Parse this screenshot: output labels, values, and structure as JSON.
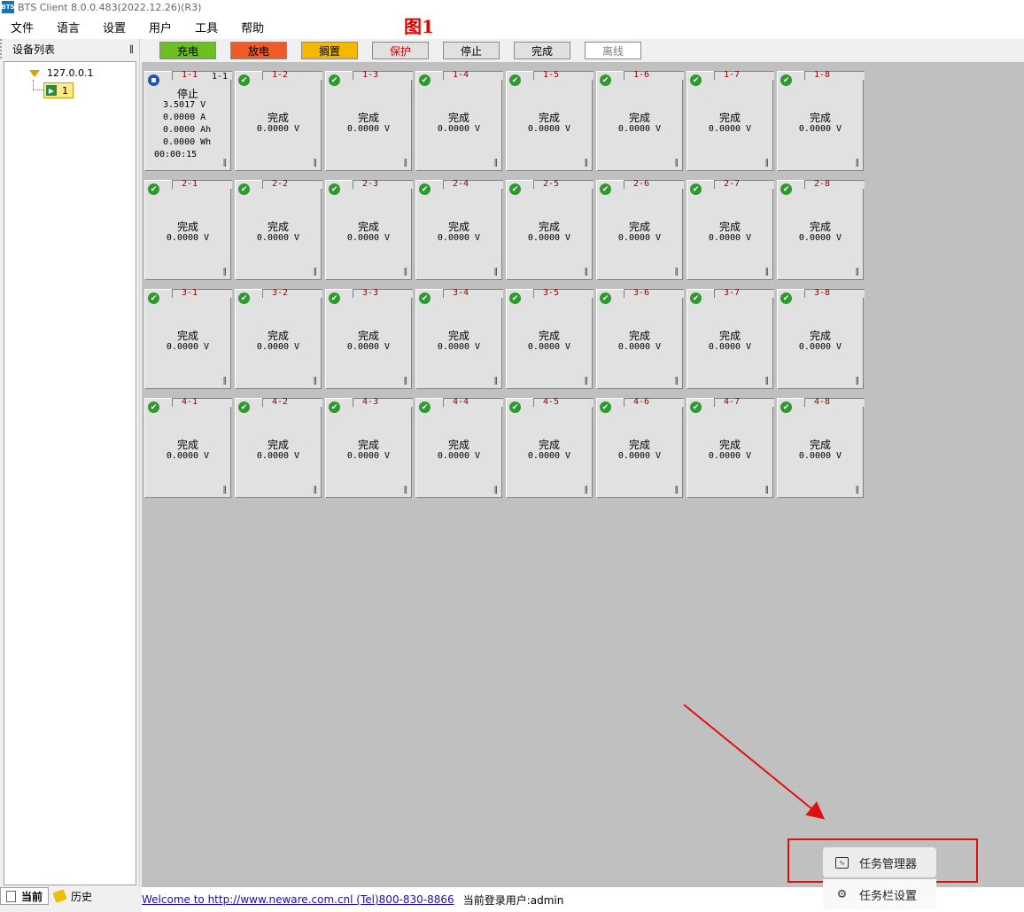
{
  "window": {
    "title": "BTS Client 8.0.0.483(2022.12.26)(R3)",
    "icon_label": "BTS"
  },
  "menu": [
    "文件",
    "语言",
    "设置",
    "用户",
    "工具",
    "帮助"
  ],
  "figure_label": "图1",
  "sidebar": {
    "title": "设备列表",
    "pin_icon": "pin-icon",
    "tree": {
      "ip": "127.0.0.1",
      "device": "1"
    },
    "tabs": [
      {
        "label": "当前",
        "active": true,
        "icon": "document-icon"
      },
      {
        "label": "历史",
        "active": false,
        "icon": "tag-icon"
      }
    ]
  },
  "legend": [
    {
      "label": "充电",
      "bg": "#6bbf20",
      "fg": "#000000"
    },
    {
      "label": "放电",
      "bg": "#f05a24",
      "fg": "#000000"
    },
    {
      "label": "搁置",
      "bg": "#f5b800",
      "fg": "#000000"
    },
    {
      "label": "保护",
      "bg": "#e1e1e1",
      "fg": "#d00000"
    },
    {
      "label": "停止",
      "bg": "#e1e1e1",
      "fg": "#000000"
    },
    {
      "label": "完成",
      "bg": "#e1e1e1",
      "fg": "#000000"
    },
    {
      "label": "离线",
      "bg": "#ffffff",
      "fg": "#808080"
    }
  ],
  "channels": {
    "rows": [
      [
        {
          "id": "1-1",
          "state": "停止",
          "icon": "stop-icon",
          "tag": "1-1",
          "details": [
            "3.5017 V",
            "0.0000 A",
            "0.0000 Ah",
            "0.0000 Wh",
            "00:00:15"
          ]
        },
        {
          "id": "1-2",
          "state": "完成",
          "value": "0.0000 V"
        },
        {
          "id": "1-3",
          "state": "完成",
          "value": "0.0000 V"
        },
        {
          "id": "1-4",
          "state": "完成",
          "value": "0.0000 V"
        },
        {
          "id": "1-5",
          "state": "完成",
          "value": "0.0000 V"
        },
        {
          "id": "1-6",
          "state": "完成",
          "value": "0.0000 V"
        },
        {
          "id": "1-7",
          "state": "完成",
          "value": "0.0000 V"
        },
        {
          "id": "1-8",
          "state": "完成",
          "value": "0.0000 V"
        }
      ],
      [
        {
          "id": "2-1",
          "state": "完成",
          "value": "0.0000 V"
        },
        {
          "id": "2-2",
          "state": "完成",
          "value": "0.0000 V"
        },
        {
          "id": "2-3",
          "state": "完成",
          "value": "0.0000 V"
        },
        {
          "id": "2-4",
          "state": "完成",
          "value": "0.0000 V"
        },
        {
          "id": "2-5",
          "state": "完成",
          "value": "0.0000 V"
        },
        {
          "id": "2-6",
          "state": "完成",
          "value": "0.0000 V"
        },
        {
          "id": "2-7",
          "state": "完成",
          "value": "0.0000 V"
        },
        {
          "id": "2-8",
          "state": "完成",
          "value": "0.0000 V"
        }
      ],
      [
        {
          "id": "3-1",
          "state": "完成",
          "value": "0.0000 V"
        },
        {
          "id": "3-2",
          "state": "完成",
          "value": "0.0000 V"
        },
        {
          "id": "3-3",
          "state": "完成",
          "value": "0.0000 V"
        },
        {
          "id": "3-4",
          "state": "完成",
          "value": "0.0000 V"
        },
        {
          "id": "3-5",
          "state": "完成",
          "value": "0.0000 V"
        },
        {
          "id": "3-6",
          "state": "完成",
          "value": "0.0000 V"
        },
        {
          "id": "3-7",
          "state": "完成",
          "value": "0.0000 V"
        },
        {
          "id": "3-8",
          "state": "完成",
          "value": "0.0000 V"
        }
      ],
      [
        {
          "id": "4-1",
          "state": "完成",
          "value": "0.0000 V"
        },
        {
          "id": "4-2",
          "state": "完成",
          "value": "0.0000 V"
        },
        {
          "id": "4-3",
          "state": "完成",
          "value": "0.0000 V"
        },
        {
          "id": "4-4",
          "state": "完成",
          "value": "0.0000 V"
        },
        {
          "id": "4-5",
          "state": "完成",
          "value": "0.0000 V"
        },
        {
          "id": "4-6",
          "state": "完成",
          "value": "0.0000 V"
        },
        {
          "id": "4-7",
          "state": "完成",
          "value": "0.0000 V"
        },
        {
          "id": "4-8",
          "state": "完成",
          "value": "0.0000 V"
        }
      ]
    ]
  },
  "status": {
    "welcome": "Welcome to http://www.neware.com.cnl (Tel)800-830-8866",
    "user": "当前登录用户:admin"
  },
  "context_menu": [
    {
      "label": "任务管理器",
      "icon": "task-manager-icon"
    },
    {
      "label": "任务栏设置",
      "icon": "gear-icon"
    }
  ],
  "annotation": {
    "color": "#e01010"
  }
}
